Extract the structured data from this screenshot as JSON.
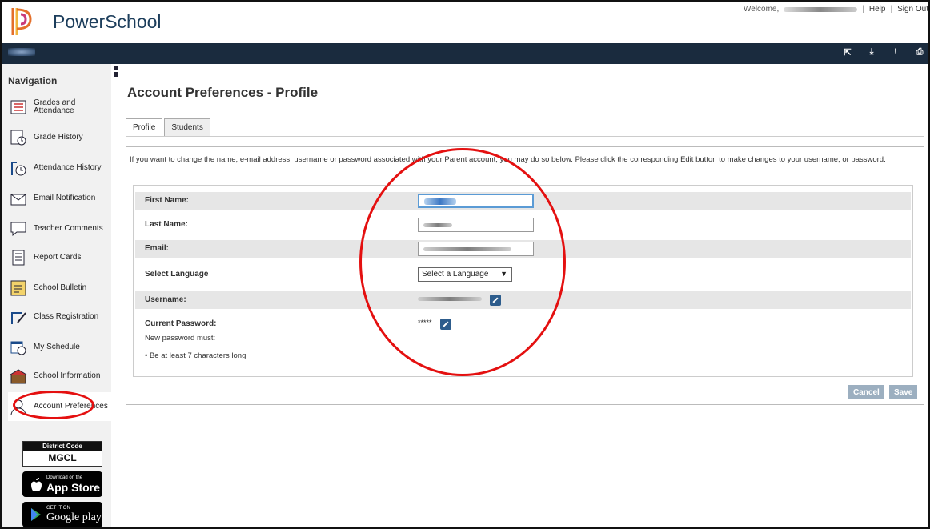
{
  "header": {
    "brand": "PowerSchool",
    "welcome": "Welcome,",
    "help": "Help",
    "sign_out": "Sign Out",
    "bar_icons": [
      "external-link-icon",
      "download-icon",
      "alert-icon",
      "print-icon"
    ]
  },
  "sidebar": {
    "title": "Navigation",
    "items": [
      {
        "label": "Grades and Attendance",
        "icon": "grades-icon"
      },
      {
        "label": "Grade History",
        "icon": "grade-history-icon"
      },
      {
        "label": "Attendance History",
        "icon": "attendance-history-icon"
      },
      {
        "label": "Email Notification",
        "icon": "email-icon"
      },
      {
        "label": "Teacher Comments",
        "icon": "comments-icon"
      },
      {
        "label": "Report Cards",
        "icon": "report-card-icon"
      },
      {
        "label": "School Bulletin",
        "icon": "bulletin-icon"
      },
      {
        "label": "Class Registration",
        "icon": "registration-icon"
      },
      {
        "label": "My Schedule",
        "icon": "schedule-icon"
      },
      {
        "label": "School Information",
        "icon": "school-icon"
      },
      {
        "label": "Account Preferences",
        "icon": "account-icon"
      }
    ],
    "district_code_label": "District Code",
    "district_code": "MGCL",
    "app_store_small": "Download on the",
    "app_store_big": "App Store",
    "google_small": "GET IT ON",
    "google_big": "Google play"
  },
  "main": {
    "title": "Account Preferences - Profile",
    "tabs": [
      "Profile",
      "Students"
    ],
    "intro": "If you want to change the name, e-mail address, username or password associated with your Parent account, you may do so below. Please click the corresponding Edit button to make changes to your username, or password.",
    "fields": {
      "first_name": "First Name:",
      "last_name": "Last Name:",
      "email": "Email:",
      "language": "Select Language",
      "language_value": "Select a Language",
      "username": "Username:",
      "password": "Current Password:",
      "password_value": "*****",
      "pw_rule_intro": "New password must:",
      "pw_rule": "• Be at least 7 characters long"
    },
    "cancel": "Cancel",
    "save": "Save"
  },
  "colors": {
    "accent": "#1a2b3e",
    "annotation": "#e41010",
    "button": "#9cafc0"
  }
}
